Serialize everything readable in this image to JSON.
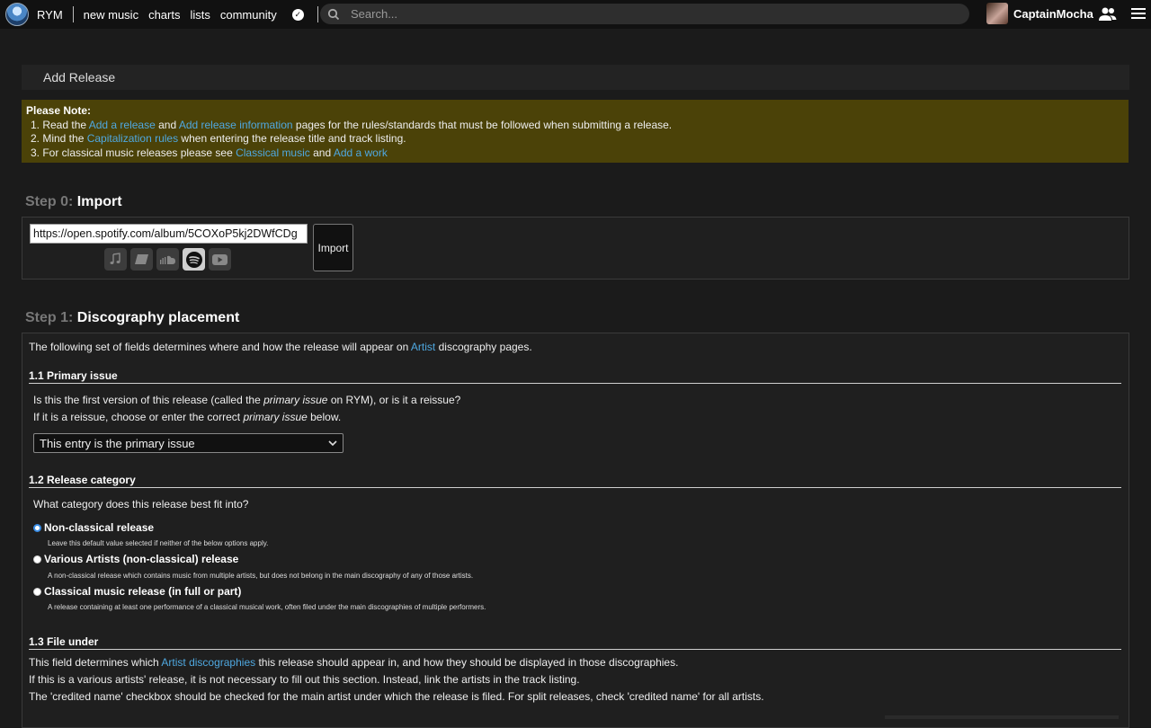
{
  "nav": {
    "brand": "RYM",
    "items": [
      "new music",
      "charts",
      "lists",
      "community"
    ],
    "search_placeholder": "Search...",
    "username": "CaptainMocha"
  },
  "page": {
    "title": "Add Release"
  },
  "note": {
    "heading": "Please Note:",
    "line1_pre": "1. Read the ",
    "line1_link1": "Add a release",
    "line1_mid": " and ",
    "line1_link2": "Add release information",
    "line1_post": " pages for the rules/standards that must be followed when submitting a release.",
    "line2_pre": "2. Mind the ",
    "line2_link": "Capitalization rules",
    "line2_post": " when entering the release title and track listing.",
    "line3_pre": "3. For classical music releases please see ",
    "line3_link1": "Classical music",
    "line3_mid": " and ",
    "line3_link2": "Add a work"
  },
  "step0": {
    "num": "Step 0:",
    "title": "Import",
    "url_value": "https://open.spotify.com/album/5COXoP5kj2DWfCDg",
    "services": [
      "apple-music-icon",
      "bandcamp-icon",
      "soundcloud-icon",
      "spotify-icon",
      "youtube-icon"
    ],
    "active_service": "spotify-icon",
    "import_label": "Import"
  },
  "step1": {
    "num": "Step 1:",
    "title": "Discography placement",
    "intro_pre": "The following set of fields determines where and how the release will appear on ",
    "intro_link": "Artist",
    "intro_post": " discography pages.",
    "s11": {
      "head": "1.1  Primary issue",
      "q1_pre": "Is this the first version of this release (called the ",
      "q1_em": "primary issue",
      "q1_post": " on RYM), or is it a reissue?",
      "q2_pre": "If it is a reissue, choose or enter the correct ",
      "q2_em": "primary issue",
      "q2_post": " below.",
      "select_value": "This entry is the primary issue"
    },
    "s12": {
      "head": "1.2  Release category",
      "question": "What category does this release best fit into?",
      "options": [
        {
          "label": "Non-classical release",
          "desc": "Leave this default value selected if neither of the below options apply.",
          "checked": true
        },
        {
          "label": "Various Artists (non-classical) release",
          "desc": "A non-classical release which contains music from multiple artists, but does not belong in the main discography of any of those artists.",
          "checked": false
        },
        {
          "label": "Classical music release (in full or part)",
          "desc": "A release containing at least one performance of a classical musical work, often filed under the main discographies of multiple performers.",
          "checked": false
        }
      ]
    },
    "s13": {
      "head": "1.3  File under",
      "l1_pre": "This field determines which ",
      "l1_link": "Artist discographies",
      "l1_post": " this release should appear in, and how they should be displayed in those discographies.",
      "l2": "If this is a various artists' release, it is not necessary to fill out this section. Instead, link the artists in the track listing.",
      "l3": "The 'credited name' checkbox should be checked for the main artist under which the release is filed. For split releases, check 'credited name' for all artists."
    }
  },
  "colors": {
    "link": "#4fa8e0",
    "note_bg": "#4b4208",
    "page_bg": "#1b1b1b"
  }
}
